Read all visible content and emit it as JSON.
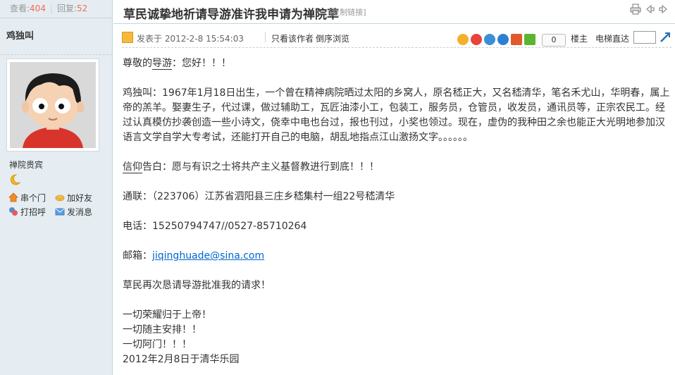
{
  "sidebar": {
    "views_label": "查看:",
    "views": "404",
    "replies_label": "回复:",
    "replies": "52",
    "author": "鸡独叫",
    "group": "禅院贵宾",
    "actions": [
      "串个门",
      "加好友",
      "打招呼",
      "发消息"
    ]
  },
  "header": {
    "title": "草民诚挚地祈请导游准许我申请为禅院草",
    "copy_link": "[复制链接]"
  },
  "meta": {
    "posted_at": "发表于 2012-2-8 15:54:03",
    "only_author": "只看该作者",
    "reverse": "倒序浏览",
    "count": "0",
    "floor": "楼主",
    "jump": "电梯直达"
  },
  "post": {
    "salutation_pre": "尊敬的",
    "salutation_kw": "导游",
    "salutation_post": "：您好！！！",
    "bio": "鸡独叫：1967年1月18日出生，一个曾在精神病院晒过太阳的乡窝人，原名嵇正大，又名嵇清华，笔名禾尤山，华明春，属上帝的羔羊。娶妻生子，代过课，做过辅助工，瓦匠油漆小工，包装工，服务员，仓管员，收发员，通讯员等，正宗农民工。经过认真模仿抄袭创造一些小诗文，侥幸中电也台过，报也刊过，小奖也领过。现在，虚伪的我种田之余也能正大光明地参加汉语言文学自学大专考试，还能打开自己的电脑，胡乱地指点江山激扬文字。。。。。。",
    "creed_kw": "信仰",
    "creed_post": "告白：愿与有识之士将共产主义基督教进行到底！！！",
    "address": "通联：（223706）江苏省泗阳县三庄乡嵇集村一组22号嵇清华",
    "phone": "电话：15250794747//0527-85710264",
    "email_label": "邮箱：",
    "email": "jiqinghuade@sina.com",
    "plea": "草民再次恳请导游批准我的请求！",
    "line1": "一切荣耀归于上帝！",
    "line2": "一切随主安排！！",
    "line3": "一切阿门！！！",
    "date": "2012年2月8日于清华乐园"
  }
}
